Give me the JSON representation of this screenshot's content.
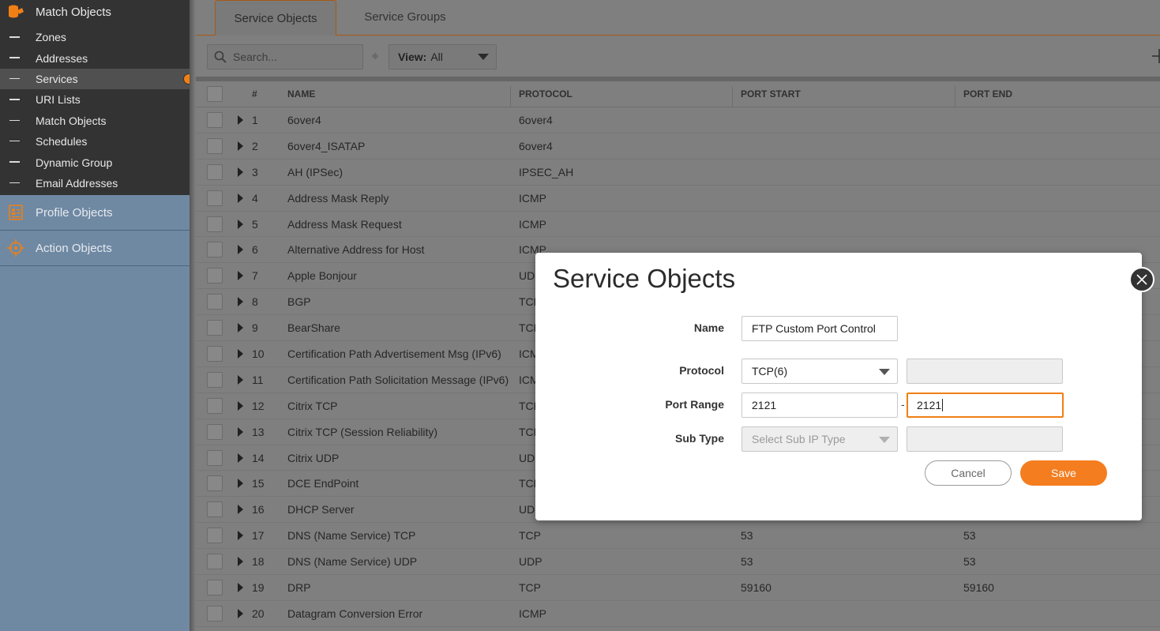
{
  "sidebar": {
    "match_objects_header": "Match Objects",
    "items": [
      {
        "label": "Zones"
      },
      {
        "label": "Addresses"
      },
      {
        "label": "Services"
      },
      {
        "label": "URI Lists"
      },
      {
        "label": "Match Objects"
      },
      {
        "label": "Schedules"
      },
      {
        "label": "Dynamic Group"
      },
      {
        "label": "Email Addresses"
      }
    ],
    "active_item": "Services",
    "profile_objects_header": "Profile Objects",
    "action_objects_header": "Action Objects"
  },
  "tabs": {
    "service_objects": "Service Objects",
    "service_groups": "Service Groups"
  },
  "toolbar": {
    "search_placeholder": "Search...",
    "view_label": "View:",
    "view_value": "All"
  },
  "table": {
    "headers": {
      "num": "#",
      "name": "NAME",
      "protocol": "PROTOCOL",
      "port_start": "PORT START",
      "port_end": "PORT END"
    },
    "rows": [
      {
        "num": "1",
        "name": "6over4",
        "protocol": "6over4",
        "port_start": "",
        "port_end": ""
      },
      {
        "num": "2",
        "name": "6over4_ISATAP",
        "protocol": "6over4",
        "port_start": "",
        "port_end": ""
      },
      {
        "num": "3",
        "name": "AH (IPSec)",
        "protocol": "IPSEC_AH",
        "port_start": "",
        "port_end": ""
      },
      {
        "num": "4",
        "name": "Address Mask Reply",
        "protocol": "ICMP",
        "port_start": "",
        "port_end": ""
      },
      {
        "num": "5",
        "name": "Address Mask Request",
        "protocol": "ICMP",
        "port_start": "",
        "port_end": ""
      },
      {
        "num": "6",
        "name": "Alternative Address for Host",
        "protocol": "ICMP",
        "port_start": "",
        "port_end": ""
      },
      {
        "num": "7",
        "name": "Apple Bonjour",
        "protocol": "UD",
        "port_start": "",
        "port_end": ""
      },
      {
        "num": "8",
        "name": "BGP",
        "protocol": "TCP",
        "port_start": "",
        "port_end": ""
      },
      {
        "num": "9",
        "name": "BearShare",
        "protocol": "TCP",
        "port_start": "",
        "port_end": ""
      },
      {
        "num": "10",
        "name": "Certification Path Advertisement Msg (IPv6)",
        "protocol": "ICM",
        "port_start": "",
        "port_end": ""
      },
      {
        "num": "11",
        "name": "Certification Path Solicitation Message (IPv6)",
        "protocol": "ICM",
        "port_start": "",
        "port_end": ""
      },
      {
        "num": "12",
        "name": "Citrix TCP",
        "protocol": "TCP",
        "port_start": "",
        "port_end": ""
      },
      {
        "num": "13",
        "name": "Citrix TCP (Session Reliability)",
        "protocol": "TCP",
        "port_start": "",
        "port_end": ""
      },
      {
        "num": "14",
        "name": "Citrix UDP",
        "protocol": "UD",
        "port_start": "",
        "port_end": ""
      },
      {
        "num": "15",
        "name": "DCE EndPoint",
        "protocol": "TCP",
        "port_start": "",
        "port_end": ""
      },
      {
        "num": "16",
        "name": "DHCP Server",
        "protocol": "UD",
        "port_start": "",
        "port_end": ""
      },
      {
        "num": "17",
        "name": "DNS (Name Service) TCP",
        "protocol": "TCP",
        "port_start": "53",
        "port_end": "53"
      },
      {
        "num": "18",
        "name": "DNS (Name Service) UDP",
        "protocol": "UDP",
        "port_start": "53",
        "port_end": "53"
      },
      {
        "num": "19",
        "name": "DRP",
        "protocol": "TCP",
        "port_start": "59160",
        "port_end": "59160"
      },
      {
        "num": "20",
        "name": "Datagram Conversion Error",
        "protocol": "ICMP",
        "port_start": "",
        "port_end": ""
      }
    ]
  },
  "modal": {
    "title": "Service Objects",
    "name_label": "Name",
    "name_value": "FTP Custom Port Control",
    "protocol_label": "Protocol",
    "protocol_value": "TCP(6)",
    "port_range_label": "Port Range",
    "port_start_value": "2121",
    "range_separator": "-",
    "port_end_value": "2121",
    "sub_type_label": "Sub Type",
    "sub_type_placeholder": "Select Sub IP Type",
    "cancel_label": "Cancel",
    "save_label": "Save"
  },
  "colors": {
    "accent": "#f47d1f",
    "sidebar_dark": "#333333",
    "sidebar_blue": "#6f89a3"
  }
}
